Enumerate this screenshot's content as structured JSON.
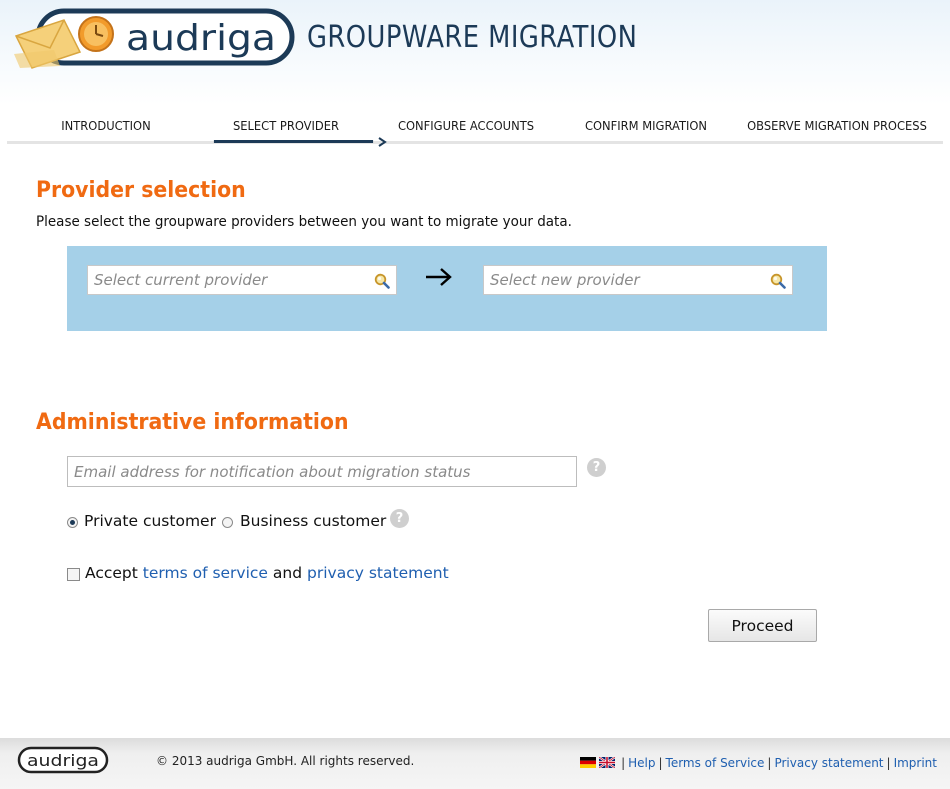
{
  "header": {
    "brand_name": "audriga",
    "app_title": "GROUPWARE MIGRATION"
  },
  "steps": [
    {
      "label": "INTRODUCTION",
      "active": false
    },
    {
      "label": "SELECT PROVIDER",
      "active": true
    },
    {
      "label": "CONFIGURE ACCOUNTS",
      "active": false
    },
    {
      "label": "CONFIRM MIGRATION",
      "active": false
    },
    {
      "label": "OBSERVE MIGRATION PROCESS",
      "active": false
    }
  ],
  "provider_section": {
    "title": "Provider selection",
    "intro": "Please select the groupware providers between you want to migrate your data.",
    "current_provider_placeholder": "Select current provider",
    "new_provider_placeholder": "Select new provider",
    "arrow": "→",
    "panel_color": "#a5d0e8"
  },
  "admin_section": {
    "title": "Administrative information",
    "email_placeholder": "Email address for notification about migration status",
    "help_glyph": "?",
    "customer_types": [
      {
        "label": "Private customer",
        "selected": true
      },
      {
        "label": "Business customer",
        "selected": false
      }
    ],
    "accept_prefix": "Accept",
    "terms_link": "terms of service",
    "and_text": "and",
    "privacy_link": "privacy statement",
    "accepted": false
  },
  "proceed_label": "Proceed",
  "footer": {
    "brand_name": "audriga",
    "copyright": "© 2013 audriga GmbH. All rights reserved.",
    "links": [
      "Help",
      "Terms of Service",
      "Privacy statement",
      "Imprint"
    ],
    "languages": [
      "german-flag-icon",
      "uk-flag-icon"
    ]
  },
  "colors": {
    "accent_orange": "#f06a12",
    "brand_navy": "#1c3a57",
    "link_blue": "#1f5fb0"
  }
}
